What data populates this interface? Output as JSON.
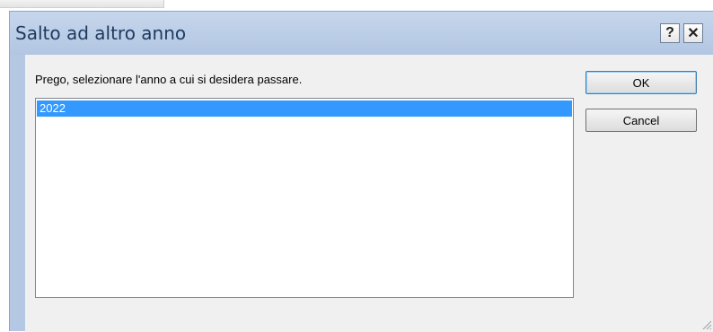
{
  "dialog": {
    "title": "Salto ad altro anno",
    "help_glyph": "?",
    "close_glyph": "✕",
    "prompt": "Prego, selezionare l'anno a cui si desidera passare.",
    "year_list": {
      "items": [
        "2022"
      ],
      "selected": "2022"
    },
    "ok_label": "OK",
    "cancel_label": "Cancel"
  },
  "colors": {
    "selection": "#3399ff",
    "title_text": "#1e3a5f",
    "frame": "#b4c8e4"
  }
}
